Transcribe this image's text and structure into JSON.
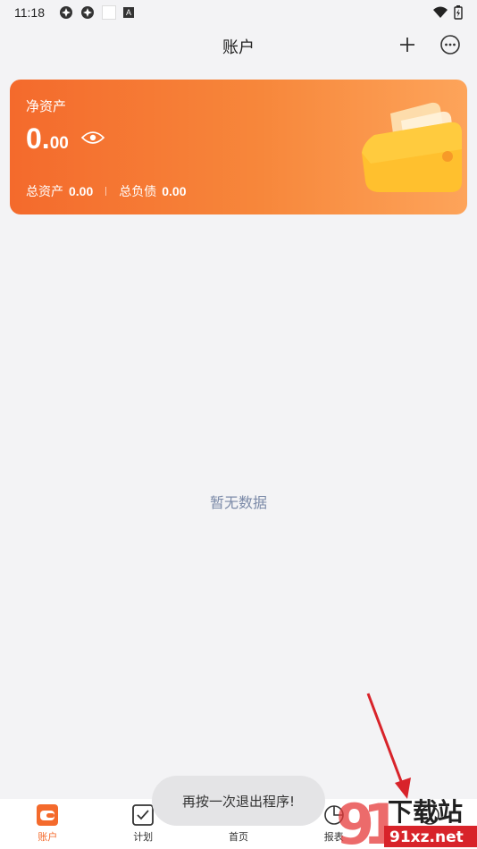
{
  "status_bar": {
    "time": "11:18",
    "badge_letter": "A"
  },
  "header": {
    "title": "账户"
  },
  "card": {
    "net_label": "净资产",
    "net_int": "0.",
    "net_dec": "00",
    "total_assets_label": "总资产",
    "total_assets_value": "0.00",
    "total_liabilities_label": "总负债",
    "total_liabilities_value": "0.00",
    "accent": "#f46a2c"
  },
  "empty_state": {
    "text": "暂无数据"
  },
  "toast": {
    "text": "再按一次退出程序!"
  },
  "tabs": [
    {
      "label": "账户",
      "icon": "wallet-icon",
      "active": true
    },
    {
      "label": "计划",
      "icon": "checkbox-icon",
      "active": false
    },
    {
      "label": "首页",
      "icon": "home-icon",
      "active": false
    },
    {
      "label": "报表",
      "icon": "chart-icon",
      "active": false
    },
    {
      "label": "",
      "icon": "more-icon",
      "active": false
    }
  ],
  "watermark": {
    "brand": "下载站",
    "site": "91xz.net"
  }
}
